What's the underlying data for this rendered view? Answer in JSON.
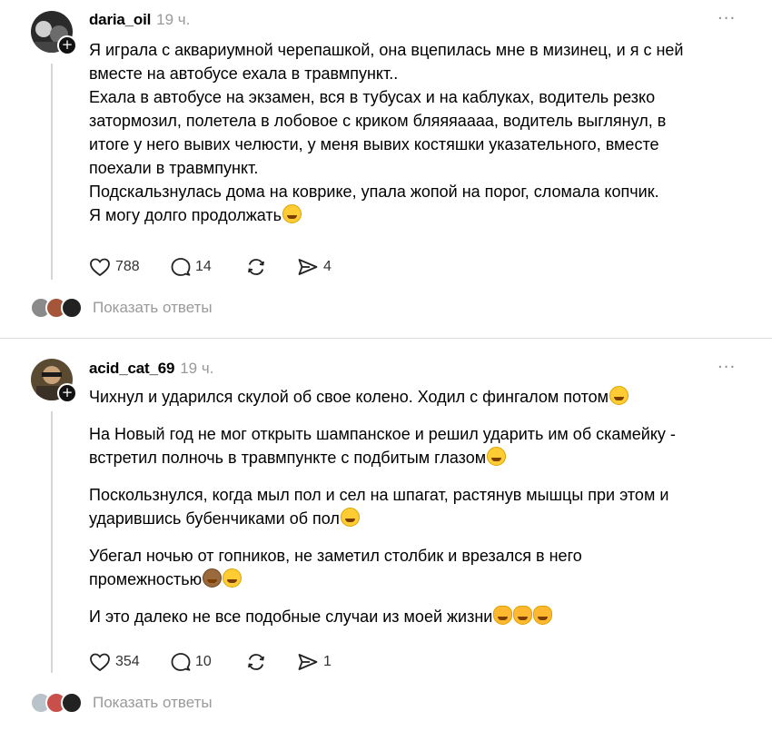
{
  "posts": [
    {
      "username": "daria_oil",
      "time": "19 ч.",
      "more": "···",
      "lines": [
        "Я играла с аквариумной черепашкой, она вцепилась мне в мизинец, и я с ней",
        "вместе на автобусе ехала в травмпункт..",
        "Ехала в автобусе на экзамен, вся в тубусах и на каблуках, водитель резко",
        "затормозил, полетела в лобовое с криком бляяяаааа, водитель выглянул, в",
        "итоге у него вывих челюсти, у меня вывих костяшки указательного, вместе",
        "поехали в травмпункт.",
        "Подскальзнулась дома на коврике, упала жопой на порог, сломала копчик.",
        "Я могу долго продолжать"
      ],
      "likes": "788",
      "comments": "14",
      "shares": "4",
      "show_replies": "Показать ответы"
    },
    {
      "username": "acid_cat_69",
      "time": "19 ч.",
      "more": "···",
      "paragraphs": [
        [
          "Чихнул и ударился скулой об свое колено. Ходил с фингалом потом"
        ],
        [
          "На Новый год не мог открыть шампанское и решил ударить им об скамейку -",
          "встретил полночь в травмпункте с подбитым глазом"
        ],
        [
          "Поскользнулся, когда мыл пол и сел на шпагат, растянув мышцы при этом и",
          "ударившись бубенчиками об пол"
        ],
        [
          "Убегал ночью от гопников, не заметил столбик и врезался в него",
          "промежностью"
        ],
        [
          "И это далеко не все подобные случаи из моей жизни"
        ]
      ],
      "likes": "354",
      "comments": "10",
      "shares": "1",
      "show_replies": "Показать ответы"
    }
  ],
  "icons": {
    "like": "heart-icon",
    "comment": "comment-icon",
    "repost": "repost-icon",
    "share": "send-icon",
    "more": "more-dots-icon",
    "follow": "plus-icon",
    "emoji_laugh": "grinning-sweat-emoji",
    "emoji_cat": "cat-emoji",
    "emoji_monkey": "see-no-evil-monkey-emoji"
  },
  "colors": {
    "text": "#000000",
    "muted": "#9a9a9a",
    "divider": "#dcdcdc",
    "thread_line": "#d6d6d6"
  }
}
